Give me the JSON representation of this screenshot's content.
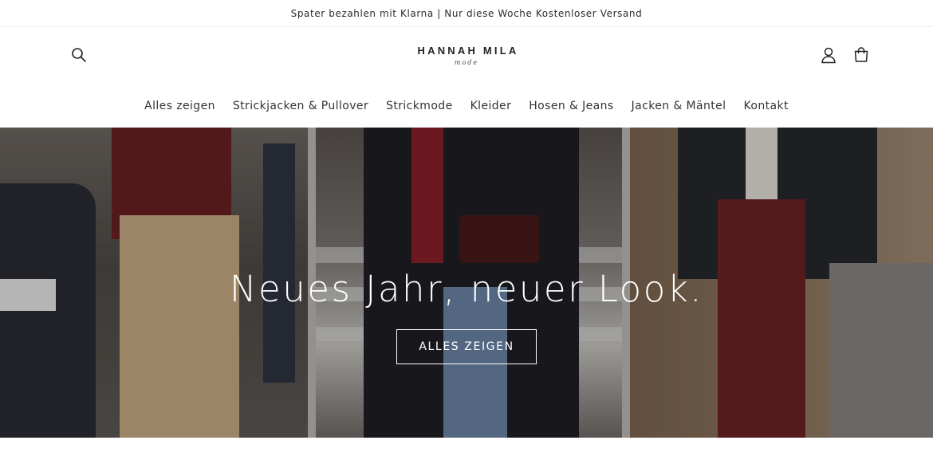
{
  "announcement": {
    "text": "Spater bezahlen mit Klarna | Nur diese Woche Kostenloser Versand"
  },
  "header": {
    "logo_main": "HANNAH MILA",
    "logo_sub": "mode",
    "icons": {
      "search": "search-icon",
      "account": "account-icon",
      "cart": "cart-icon"
    }
  },
  "nav": {
    "items": [
      {
        "label": "Alles zeigen"
      },
      {
        "label": "Strickjacken & Pullover"
      },
      {
        "label": "Strickmode"
      },
      {
        "label": "Kleider"
      },
      {
        "label": "Hosen & Jeans"
      },
      {
        "label": "Jacken & Mäntel"
      },
      {
        "label": "Kontakt"
      }
    ]
  },
  "hero": {
    "title": "Neues Jahr, neuer Look.",
    "button_label": "ALLES ZEIGEN"
  },
  "colors": {
    "text": "#222222",
    "background": "#ffffff",
    "hero_text": "#ffffff"
  }
}
